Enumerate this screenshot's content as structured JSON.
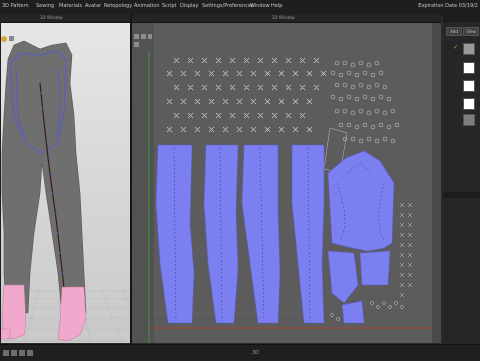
{
  "menu": {
    "items": [
      "3D Pattern",
      "Sewing",
      "Materials",
      "Avatar",
      "Retopology",
      "Animation",
      "Script",
      "Display",
      "Settings/Preferences",
      "Window",
      "Help"
    ],
    "expiration": "Expiration Date 03/19/2"
  },
  "panels": {
    "left_title": "3D Window",
    "center_title": "2D Window"
  },
  "right_panel": {
    "button_1": "Add",
    "button_2": "View",
    "swatches": [
      "#9a9a9a",
      "#ffffff",
      "#ffffff",
      "#ffffff",
      "#7d7d7d"
    ],
    "checkmark": "✓"
  },
  "status": {
    "bottom_label": "3D"
  },
  "colors": {
    "pattern_fill": "#7b7ff0",
    "avatar_pink": "#f0a8cc",
    "garment_grey": "#6f6f6f"
  }
}
